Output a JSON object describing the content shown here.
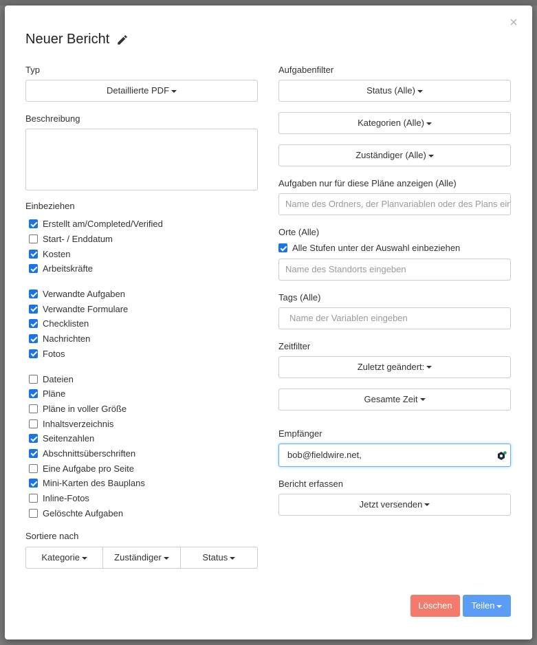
{
  "modal": {
    "title": "Neuer Bericht",
    "close_glyph": "×",
    "pencil_icon": "pencil-icon"
  },
  "left": {
    "type_label": "Typ",
    "type_value": "Detaillierte PDF",
    "description_label": "Beschreibung",
    "include_label": "Einbeziehen",
    "include_groups": [
      [
        {
          "label": "Erstellt am/Completed/Verified",
          "checked": true
        },
        {
          "label": "Start- / Enddatum",
          "checked": false
        },
        {
          "label": "Kosten",
          "checked": true
        },
        {
          "label": "Arbeitskräfte",
          "checked": true
        }
      ],
      [
        {
          "label": "Verwandte Aufgaben",
          "checked": true
        },
        {
          "label": "Verwandte Formulare",
          "checked": true
        },
        {
          "label": "Checklisten",
          "checked": true
        },
        {
          "label": "Nachrichten",
          "checked": true
        },
        {
          "label": "Fotos",
          "checked": true
        }
      ],
      [
        {
          "label": "Dateien",
          "checked": false
        },
        {
          "label": "Pläne",
          "checked": true
        },
        {
          "label": "Pläne in voller Größe",
          "checked": false
        },
        {
          "label": "Inhaltsverzeichnis",
          "checked": false
        },
        {
          "label": "Seitenzahlen",
          "checked": true
        },
        {
          "label": "Abschnittsüberschriften",
          "checked": true
        },
        {
          "label": "Eine Aufgabe pro Seite",
          "checked": false
        },
        {
          "label": "Mini-Karten des Bauplans",
          "checked": true
        },
        {
          "label": "Inline-Fotos",
          "checked": false
        },
        {
          "label": "Gelöschte Aufgaben",
          "checked": false
        }
      ]
    ],
    "sort_label": "Sortiere nach",
    "sort_options": [
      "Kategorie",
      "Zuständiger",
      "Status"
    ]
  },
  "right": {
    "task_filter_label": "Aufgabenfilter",
    "status_btn": "Status (Alle)",
    "categories_btn": "Kategorien (Alle)",
    "assignee_btn": "Zuständiger (Alle)",
    "plans_label": "Aufgaben nur für diese Pläne anzeigen (Alle)",
    "plans_placeholder": "Name des Ordners, der Planvariablen oder des Plans eingeben",
    "locations_label": "Orte (Alle)",
    "include_sublevels": "Alle Stufen unter der Auswahl einbeziehen",
    "include_sublevels_checked": true,
    "location_placeholder": "Name des Standorts eingeben",
    "tags_label": "Tags (Alle)",
    "tags_placeholder": "Name der Variablen eingeben",
    "time_filter_label": "Zeitfilter",
    "last_changed_btn": "Zuletzt geändert:",
    "total_time_btn": "Gesamte Zeit",
    "recipients_label": "Empfänger",
    "recipients_value": "bob@fieldwire.net,",
    "capture_label": "Bericht erfassen",
    "send_now_btn": "Jetzt versenden"
  },
  "footer": {
    "delete_label": "Löschen",
    "share_label": "Teilen"
  },
  "colors": {
    "delete_bg": "#f47b6b",
    "share_bg": "#5b9cf6",
    "checkbox": "#1a73e8"
  }
}
